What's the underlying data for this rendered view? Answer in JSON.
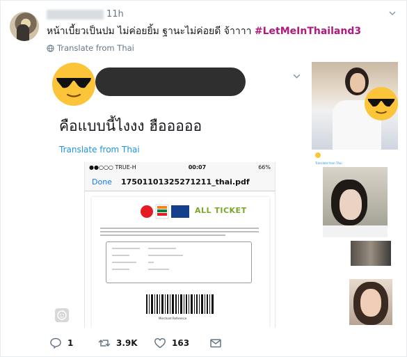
{
  "tweet": {
    "time": "11h",
    "text": "หน้าเบี้ยวเป็นปม ไม่ค่อยยิ้ม ฐานะไม่ค่อยดี จ้าาาา ",
    "hashtag": "#LetMeInThailand3",
    "translate_label": "Translate from Thai"
  },
  "quoted": {
    "text": "คือแบบนี้ไงงง ฮือออออ",
    "translate_label": "Translate from Thai",
    "status_bar": {
      "carrier": "●●○○○ TRUE-H",
      "time": "00:07",
      "battery": "66%"
    },
    "nav": {
      "done_label": "Done",
      "pdf_title": "17501101325271211_thai.pdf"
    },
    "ticket_brand": "ALL TICKET",
    "barcode_label": "Merchant Reference"
  },
  "side": {
    "translate_label": "Translate from Thai"
  },
  "actions": {
    "reply_count": "1",
    "retweet_count": "3.9K",
    "like_count": "163"
  },
  "colors": {
    "hashtag": "#b0197e",
    "link": "#1b95e0",
    "muted": "#657786",
    "emoji": "#fcc438"
  }
}
